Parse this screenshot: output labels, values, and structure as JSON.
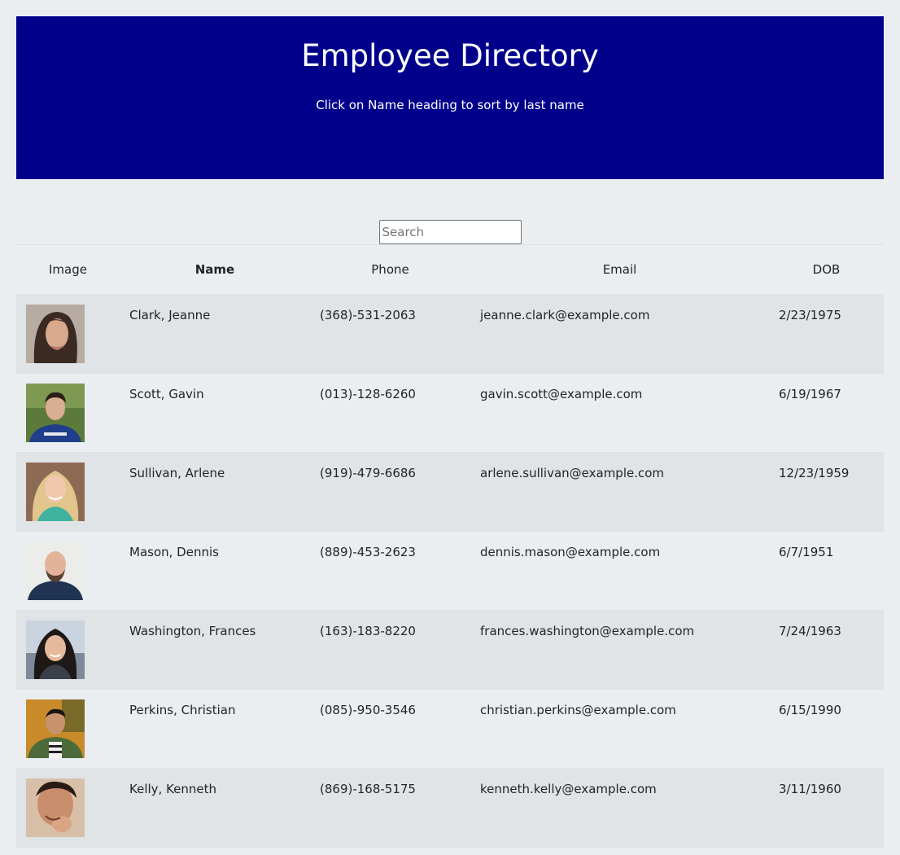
{
  "header": {
    "title": "Employee Directory",
    "subtitle": "Click on Name heading to sort by last name"
  },
  "search": {
    "placeholder": "Search",
    "value": ""
  },
  "table": {
    "columns": {
      "image": "Image",
      "name": "Name",
      "phone": "Phone",
      "email": "Email",
      "dob": "DOB"
    },
    "rows": [
      {
        "name": "Clark, Jeanne",
        "phone": "(368)-531-2063",
        "email": "jeanne.clark@example.com",
        "dob": "2/23/1975",
        "photo": "woman-dark-hair"
      },
      {
        "name": "Scott, Gavin",
        "phone": "(013)-128-6260",
        "email": "gavin.scott@example.com",
        "dob": "6/19/1967",
        "photo": "man-outdoors-green"
      },
      {
        "name": "Sullivan, Arlene",
        "phone": "(919)-479-6686",
        "email": "arlene.sullivan@example.com",
        "dob": "12/23/1959",
        "photo": "woman-blonde"
      },
      {
        "name": "Mason, Dennis",
        "phone": "(889)-453-2623",
        "email": "dennis.mason@example.com",
        "dob": "6/7/1951",
        "photo": "man-bald-beard"
      },
      {
        "name": "Washington, Frances",
        "phone": "(163)-183-8220",
        "email": "frances.washington@example.com",
        "dob": "7/24/1963",
        "photo": "woman-dark-hair-city"
      },
      {
        "name": "Perkins, Christian",
        "phone": "(085)-950-3546",
        "email": "christian.perkins@example.com",
        "dob": "6/15/1990",
        "photo": "man-autumn-jacket"
      },
      {
        "name": "Kelly, Kenneth",
        "phone": "(869)-168-5175",
        "email": "kenneth.kelly@example.com",
        "dob": "3/11/1960",
        "photo": "man-smiling-hand"
      }
    ]
  },
  "colors": {
    "header_background": "#00008b",
    "page_background": "#eaeef1",
    "striped_row": "#e0e4e7"
  }
}
